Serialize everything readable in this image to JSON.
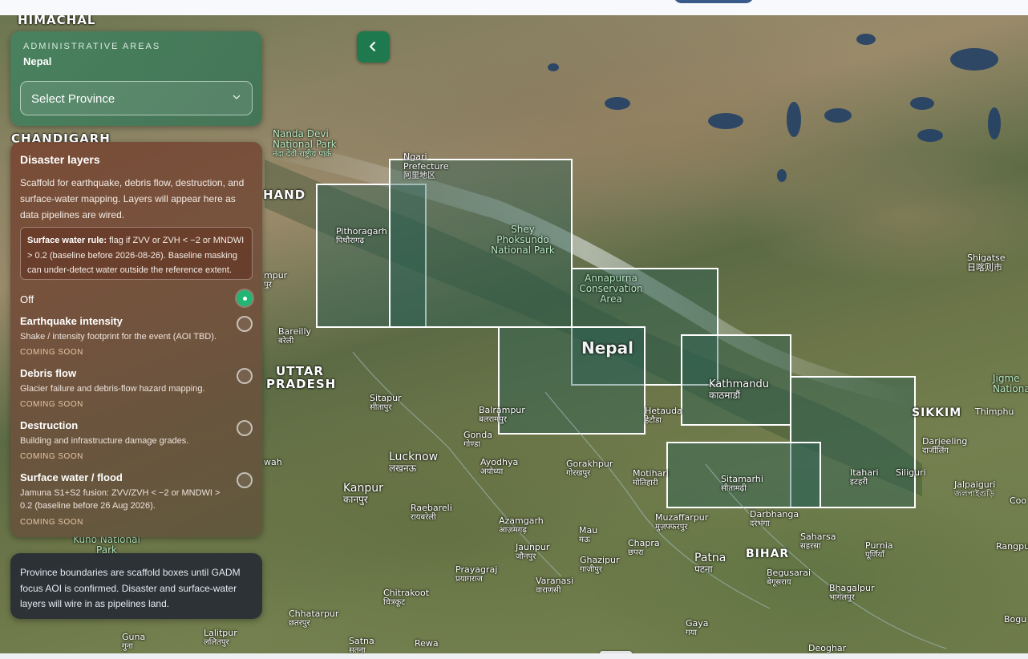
{
  "admin": {
    "kicker": "ADMINISTRATIVE AREAS",
    "country": "Nepal",
    "select_value": "Select Province"
  },
  "disaster": {
    "title": "Disaster layers",
    "description": "Scaffold for earthquake, debris flow, destruction, and surface-water mapping. Layers will appear here as data pipelines are wired.",
    "rule_label": "Surface water rule:",
    "rule_text": " flag if ZVV or ZVH < −2 or MNDWI > 0.2 (baseline before 2026-08-26). Baseline masking can under-detect water outside the reference extent.",
    "off_label": "Off",
    "selected": "Off",
    "layers": [
      {
        "label": "Earthquake intensity",
        "desc": "Shake / intensity footprint for the event (AOI TBD).",
        "status": "COMING SOON"
      },
      {
        "label": "Debris flow",
        "desc": "Glacier failure and debris-flow hazard mapping.",
        "status": "COMING SOON"
      },
      {
        "label": "Destruction",
        "desc": "Building and infrastructure damage grades.",
        "status": "COMING SOON"
      },
      {
        "label": "Surface water / flood",
        "desc": "Jamuna S1+S2 fusion: ZVV/ZVH < −2 or MNDWI > 0.2 (baseline before 26 Aug 2026).",
        "status": "COMING SOON"
      }
    ]
  },
  "note": "Province boundaries are scaffold boxes until GADM focus AOI is confirmed. Disaster and surface-water layers will wire in as pipelines land.",
  "map": {
    "icons": {
      "back": "chevron-left-icon",
      "select": "chevron-down-icon"
    },
    "colors": {
      "accent": "#1e7a4e",
      "radio_on": "#22b573",
      "box_stroke": "#ffffff"
    },
    "labels": {
      "himachal": "HIMACHAL",
      "chandigarh": "CHANDIGARH",
      "hand": "HAND",
      "nanda_devi": "Nanda Devi National Park",
      "nanda_devi_local": "नंदा देवी राष्ट्रीय पार्क",
      "ngari": "Ngari Prefecture",
      "ngari_local": "阿里地区",
      "pithoragarh": "Pithoragarh",
      "pithoragarh_local": "पिथौरागढ़",
      "shey": "Shey Phoksundo National Park",
      "annapurna": "Annapurna Conservation Area",
      "nepal": "Nepal",
      "kathmandu": "Kathmandu",
      "kathmandu_local": "काठमाडौं",
      "shigatse": "Shigatse",
      "shigatse_local": "日喀则市",
      "sikkim": "SIKKIM",
      "thimphu": "Thimphu",
      "jigme": "Jigme National",
      "darjeeling": "Darjeeling",
      "darjeeling_local": "दार्जीलिंग",
      "siliguri": "Siliguri",
      "jalpaiguri": "Jalpaiguri",
      "jalpaiguri_local": "জলপাইগুড়ি",
      "coo": "Coo",
      "itahari": "Itahari",
      "itahari_local": "इटहरी",
      "sitamarhi": "Sitamarhi",
      "sitamarhi_local": "सीतामढ़ी",
      "darbhanga": "Darbhanga",
      "darbhanga_local": "दरभंगा",
      "muzaffarpur": "Muzaffarpur",
      "muzaffarpur_local": "मुज़फ्फरपुर",
      "saharsa": "Saharsa",
      "saharsa_local": "सहरसा",
      "purnia": "Purnia",
      "purnia_local": "पूर्णियाँ",
      "bihar": "BIHAR",
      "rangpu": "Rangpu",
      "chapra": "Chapra",
      "chapra_local": "छपरा",
      "patna": "Patna",
      "patna_local": "पटना",
      "begusarai": "Begusarai",
      "begusarai_local": "बेगूसराय",
      "bhagalpur": "Bhagalpur",
      "bhagalpur_local": "भागलपुर",
      "gaya": "Gaya",
      "gaya_local": "गया",
      "bogu": "Bogu",
      "deoghar": "Deoghar",
      "hetauda": "Hetauda",
      "hetauda_local": "हेटौडा",
      "motihari": "Motihari",
      "motihari_local": "मोतिहारी",
      "gorakhpur": "Gorakhpur",
      "gorakhpur_local": "गोरखपुर",
      "balrampur": "Balrampur",
      "balrampur_local": "बलरामपुर",
      "gonda": "Gonda",
      "gonda_local": "गोण्डा",
      "ayodhya": "Ayodhya",
      "ayodhya_local": "अयोध्या",
      "sitapur": "Sitapur",
      "sitapur_local": "सीतापुर",
      "lucknow": "Lucknow",
      "lucknow_local": "लखनऊ",
      "kanpur": "Kanpur",
      "kanpur_local": "कानपुर",
      "raebareli": "Raebareli",
      "raebareli_local": "रायबरेली",
      "azamgarh": "Azamgarh",
      "azamgarh_local": "आज़मगढ़",
      "mau": "Mau",
      "mau_local": "मऊ",
      "jaunpur": "Jaunpur",
      "jaunpur_local": "जौनपुर",
      "ghazipur": "Ghazipur",
      "ghazipur_local": "ग़ाज़ीपुर",
      "varanasi": "Varanasi",
      "varanasi_local": "वाराणसी",
      "prayagraj": "Prayagraj",
      "prayagraj_local": "प्रयागराज",
      "chitrakoot": "Chitrakoot",
      "chitrakoot_local": "चित्रकूट",
      "chhatarpur": "Chhatarpur",
      "chhatarpur_local": "छतरपुर",
      "satna": "Satna",
      "satna_local": "सतना",
      "rewa": "Rewa",
      "guna": "Guna",
      "guna_local": "गुना",
      "lalitpur": "Lalitpur",
      "lalitpur_local": "ललितपुर",
      "uttar": "UTTAR",
      "pradesh": "PRADESH",
      "bareilly": "Bareilly",
      "bareilly_local": "बरेली",
      "rampur_frag": "mpur",
      "rampur_frag_local": "पुर",
      "wah": "wah",
      "kuno": "Kuno National Park"
    }
  }
}
